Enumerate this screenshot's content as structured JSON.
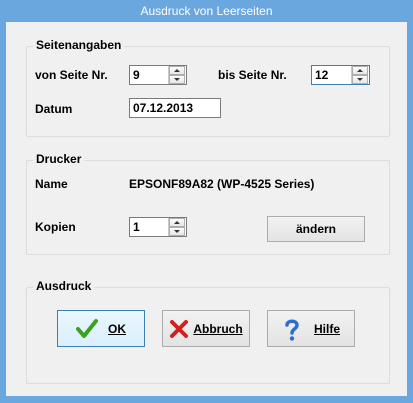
{
  "window": {
    "title": "Ausdruck von Leerseiten"
  },
  "seitenangaben": {
    "legend": "Seitenangaben",
    "von_label": "von Seite Nr.",
    "von_value": "9",
    "bis_label": "bis Seite Nr.",
    "bis_value": "12",
    "datum_label": "Datum",
    "datum_value": "07.12.2013"
  },
  "drucker": {
    "legend": "Drucker",
    "name_label": "Name",
    "name_value": "EPSONF89A82 (WP-4525 Series)",
    "kopien_label": "Kopien",
    "kopien_value": "1",
    "aendern_label": "ändern"
  },
  "ausdruck": {
    "legend": "Ausdruck",
    "ok_label": "OK",
    "abbruch_label": "Abbruch",
    "hilfe_label": "Hilfe"
  },
  "icons": {
    "ok": "checkmark-icon",
    "abbruch": "red-x-icon",
    "hilfe": "question-mark-icon"
  },
  "colors": {
    "titlebar": "#6aa7de",
    "ok_check": "#3aa21b",
    "cancel_x": "#d02020",
    "help_q": "#2a6ed0"
  }
}
